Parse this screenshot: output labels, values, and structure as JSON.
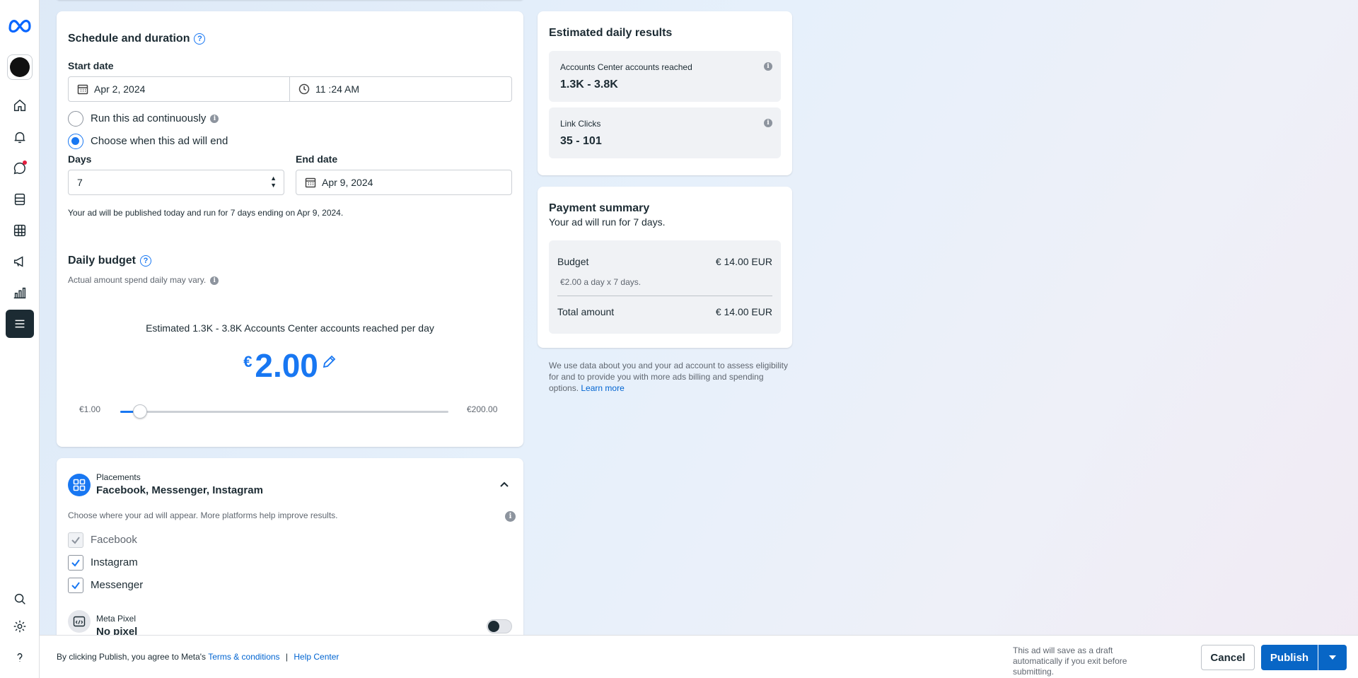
{
  "sidebar": {
    "items": [
      "home-icon",
      "notifications-icon",
      "messages-icon",
      "pages-icon",
      "table-icon",
      "ads-icon",
      "insights-icon",
      "menu-icon"
    ],
    "bottom": [
      "search-icon",
      "settings-icon",
      "help-icon"
    ]
  },
  "schedule": {
    "title": "Schedule and duration",
    "help": "?",
    "start_label": "Start date",
    "start_date": "Apr 2, 2024",
    "start_time": "11 :24 AM",
    "run_continuously": "Run this ad continuously",
    "choose_end": "Choose when this ad will end",
    "days_label": "Days",
    "days_value": "7",
    "end_label": "End date",
    "end_date": "Apr 9, 2024",
    "note": "Your ad will be published today and run for 7 days ending on Apr 9, 2024."
  },
  "budget": {
    "title": "Daily budget",
    "help": "?",
    "sub": "Actual amount spend daily may vary.",
    "estimate": "Estimated 1.3K - 3.8K Accounts Center accounts reached per day",
    "currency": "€",
    "amount": "2.00",
    "min": "€1.00",
    "max": "€200.00",
    "slider_fraction": 0.06
  },
  "placements": {
    "label": "Placements",
    "value": "Facebook, Messenger, Instagram",
    "desc": "Choose where your ad will appear. More platforms help improve results.",
    "items": [
      {
        "label": "Facebook",
        "checked": true,
        "disabled": true
      },
      {
        "label": "Instagram",
        "checked": true,
        "disabled": false
      },
      {
        "label": "Messenger",
        "checked": true,
        "disabled": false
      }
    ],
    "pixel_label": "Meta Pixel",
    "pixel_value": "No pixel"
  },
  "estimated": {
    "title": "Estimated daily results",
    "reach_label": "Accounts Center accounts reached",
    "reach_value": "1.3K - 3.8K",
    "clicks_label": "Link Clicks",
    "clicks_value": "35 - 101"
  },
  "payment": {
    "title": "Payment summary",
    "sub": "Your ad will run for 7 days.",
    "budget_label": "Budget",
    "budget_value": "€ 14.00 EUR",
    "budget_detail": "€2.00 a day x 7 days.",
    "total_label": "Total amount",
    "total_value": "€ 14.00 EUR",
    "disclaimer": "We use data about you and your ad account to assess eligibility for and to provide you with more ads billing and spending options.",
    "learn_more": "Learn more"
  },
  "footer": {
    "agree": "By clicking Publish, you agree to Meta's",
    "terms": "Terms & conditions",
    "sep": "|",
    "help_center": "Help Center",
    "draft_note": "This ad will save as a draft automatically if you exit before submitting.",
    "cancel": "Cancel",
    "publish": "Publish"
  },
  "colors": {
    "accent": "#1877f2",
    "publish": "#0866c6"
  }
}
